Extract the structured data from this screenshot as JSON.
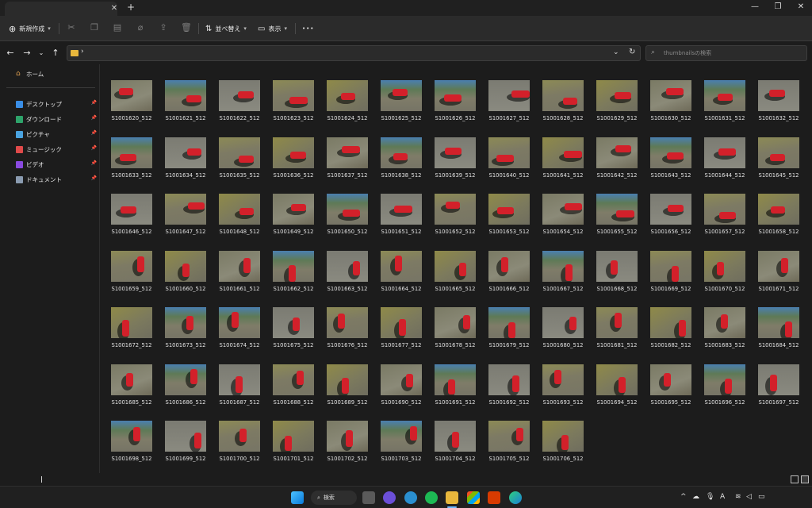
{
  "window": {
    "tab_title": "",
    "new_tab_label": "+",
    "minimize_label": "—",
    "maximize_label": "❐",
    "close_label": "✕"
  },
  "command_bar": {
    "new_label": "新規作成",
    "sort_label": "並べ替え",
    "view_label": "表示",
    "more_label": "•••"
  },
  "address": {
    "separator": "›",
    "search_placeholder": "thumbnailsの検索"
  },
  "sidebar": {
    "home": "ホーム",
    "items": [
      {
        "label": "デスクトップ",
        "color": "#3a8ee6"
      },
      {
        "label": "ダウンロード",
        "color": "#2ea36a"
      },
      {
        "label": "ピクチャ",
        "color": "#4aa3e0"
      },
      {
        "label": "ミュージック",
        "color": "#e04a4a"
      },
      {
        "label": "ビデオ",
        "color": "#8a4ae0"
      },
      {
        "label": "ドキュメント",
        "color": "#8a9bb0"
      }
    ]
  },
  "files": [
    "S1001620_512",
    "S1001621_512",
    "S1001622_512",
    "S1001623_512",
    "S1001624_512",
    "S1001625_512",
    "S1001626_512",
    "S1001627_512",
    "S1001628_512",
    "S1001629_512",
    "S1001630_512",
    "S1001631_512",
    "S1001632_512",
    "S1001633_512",
    "S1001634_512",
    "S1001635_512",
    "S1001636_512",
    "S1001637_512",
    "S1001638_512",
    "S1001639_512",
    "S1001640_512",
    "S1001641_512",
    "S1001642_512",
    "S1001643_512",
    "S1001644_512",
    "S1001645_512",
    "S1001646_512",
    "S1001647_512",
    "S1001648_512",
    "S1001649_512",
    "S1001650_512",
    "S1001651_512",
    "S1001652_512",
    "S1001653_512",
    "S1001654_512",
    "S1001655_512",
    "S1001656_512",
    "S1001657_512",
    "S1001658_512",
    "S1001659_512",
    "S1001660_512",
    "S1001661_512",
    "S1001662_512",
    "S1001663_512",
    "S1001664_512",
    "S1001665_512",
    "S1001666_512",
    "S1001667_512",
    "S1001668_512",
    "S1001669_512",
    "S1001670_512",
    "S1001671_512",
    "S1001672_512",
    "S1001673_512",
    "S1001674_512",
    "S1001675_512",
    "S1001676_512",
    "S1001677_512",
    "S1001678_512",
    "S1001679_512",
    "S1001680_512",
    "S1001681_512",
    "S1001682_512",
    "S1001683_512",
    "S1001684_512",
    "S1001685_512",
    "S1001686_512",
    "S1001687_512",
    "S1001688_512",
    "S1001689_512",
    "S1001690_512",
    "S1001691_512",
    "S1001692_512",
    "S1001693_512",
    "S1001694_512",
    "S1001695_512",
    "S1001696_512",
    "S1001697_512",
    "S1001698_512",
    "S1001699_512",
    "S1001700_512",
    "S1001701_512",
    "S1001702_512",
    "S1001703_512",
    "S1001704_512",
    "S1001705_512",
    "S1001706_512"
  ],
  "taskbar": {
    "search_label": "検索"
  }
}
